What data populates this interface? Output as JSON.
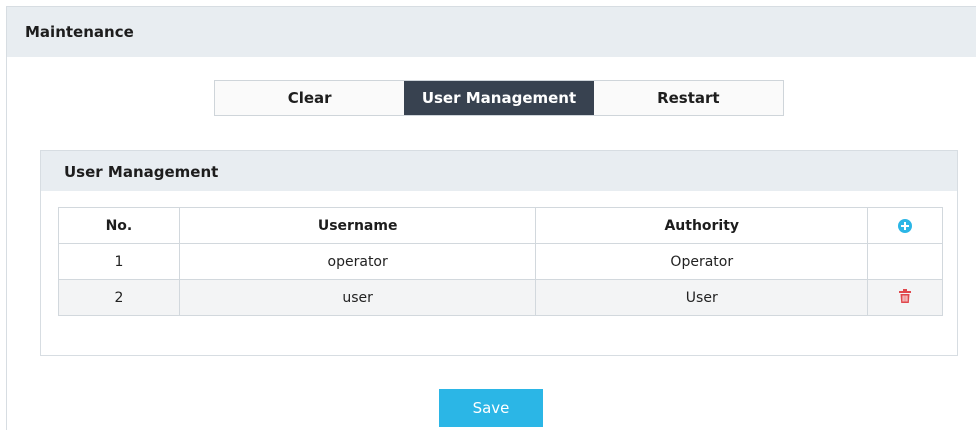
{
  "header": {
    "title": "Maintenance"
  },
  "tabs": [
    {
      "label": "Clear",
      "active": false
    },
    {
      "label": "User Management",
      "active": true
    },
    {
      "label": "Restart",
      "active": false
    }
  ],
  "panel": {
    "title": "User Management",
    "table": {
      "columns": [
        "No.",
        "Username",
        "Authority"
      ],
      "rows": [
        {
          "no": "1",
          "username": "operator",
          "authority": "Operator",
          "deletable": false
        },
        {
          "no": "2",
          "username": "user",
          "authority": "User",
          "deletable": true
        }
      ]
    },
    "icons": {
      "add": "plus-circle-icon",
      "delete": "trash-icon"
    }
  },
  "actions": {
    "save_label": "Save"
  },
  "colors": {
    "accent": "#2bb6e6",
    "active_tab": "#384250",
    "header_bg": "#e8edf1",
    "delete": "#e0484d"
  }
}
